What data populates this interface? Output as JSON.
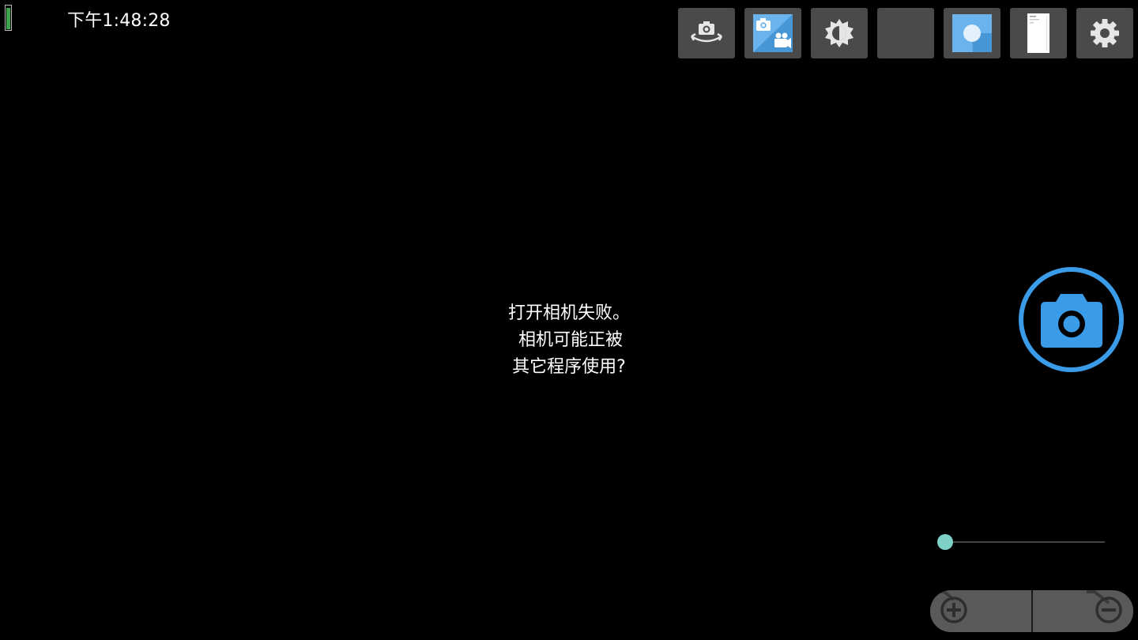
{
  "status": {
    "clock": "下午1:48:28",
    "battery_level": 0.92,
    "battery_color": "#3fa34d"
  },
  "toolbar": {
    "items": [
      {
        "icon": "switch-camera-icon",
        "active": false
      },
      {
        "icon": "photo-video-mode-icon",
        "active": true
      },
      {
        "icon": "exposure-icon",
        "active": false
      },
      {
        "icon": "blank-icon",
        "active": false
      },
      {
        "icon": "white-balance-icon",
        "active": true
      },
      {
        "icon": "document-popup-icon",
        "active": false
      },
      {
        "icon": "settings-gear-icon",
        "active": false
      }
    ]
  },
  "message": {
    "line1": "打开相机失败。",
    "line2": "相机可能正被",
    "line3": "其它程序使用?"
  },
  "shutter": {
    "icon": "camera-shutter-icon",
    "accent_color": "#3a9be8"
  },
  "zoom": {
    "level": 0.0,
    "thumb_color": "#7fd0c6",
    "zoom_in_icon": "zoom-in-plus-icon",
    "zoom_out_icon": "zoom-out-minus-icon"
  }
}
